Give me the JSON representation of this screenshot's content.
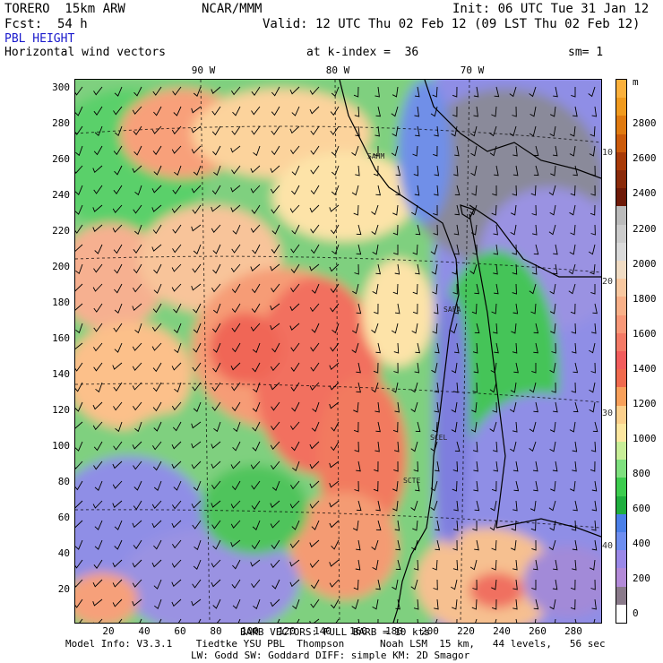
{
  "header": {
    "model": "TORERO  15km ARW",
    "org": "NCAR/MMM",
    "init": "Init: 06 UTC Tue 31 Jan 12",
    "fcst": "Fcst:  54 h",
    "valid": "Valid: 12 UTC Thu 02 Feb 12 (09 LST Thu 02 Feb 12)",
    "field": "PBL HEIGHT",
    "overlay": "Horizontal wind vectors",
    "kindex": "at k-index =  36",
    "sm": "sm= 1"
  },
  "lon_labels": [
    "90 W",
    "80 W",
    "70 W"
  ],
  "lat_labels": [
    "10 S",
    "20 S",
    "30 S",
    "40 S"
  ],
  "y_ticks": [
    "300",
    "280",
    "260",
    "240",
    "220",
    "200",
    "180",
    "160",
    "140",
    "120",
    "100",
    "80",
    "60",
    "40",
    "20"
  ],
  "x_ticks": [
    "20",
    "40",
    "60",
    "80",
    "100",
    "120",
    "140",
    "160",
    "180",
    "200",
    "220",
    "240",
    "260",
    "280"
  ],
  "stations": [
    "SAHM",
    "SAFA",
    "SCEL",
    "SCTE"
  ],
  "colorbar": {
    "unit": "m",
    "labels": [
      "2800",
      "2600",
      "2400",
      "2200",
      "2000",
      "1800",
      "1600",
      "1400",
      "1200",
      "1000",
      "800",
      "600",
      "400",
      "200",
      "0"
    ],
    "colors": [
      "#fbb03b",
      "#f09a1e",
      "#e07a10",
      "#cc5a0a",
      "#a83a08",
      "#8a2a0a",
      "#6e1a08",
      "#bbbbbb",
      "#cccccc",
      "#dadada",
      "#f0dcc4",
      "#f8c8a0",
      "#f8b088",
      "#f89878",
      "#f47a66",
      "#f25c5c",
      "#f06a4e",
      "#f8a05a",
      "#fcd08c",
      "#fde7a0",
      "#c8ee98",
      "#7ee07e",
      "#3ccc4e",
      "#1fae3e",
      "#4a7fe8",
      "#6e8ef0",
      "#9a88e8",
      "#b38ad8",
      "#8a7a8a",
      "#ffffff"
    ]
  },
  "footer": {
    "barbs": "BARB VECTORS: FULL BARB = 10 kts",
    "model_info_1": "Model Info: V3.3.1    Tiedtke YSU PBL  Thompson      Noah LSM  15 km,   44 levels,   56 sec",
    "model_info_2": "LW: Godd SW: Goddard DIFF: simple KM: 2D Smagor"
  }
}
